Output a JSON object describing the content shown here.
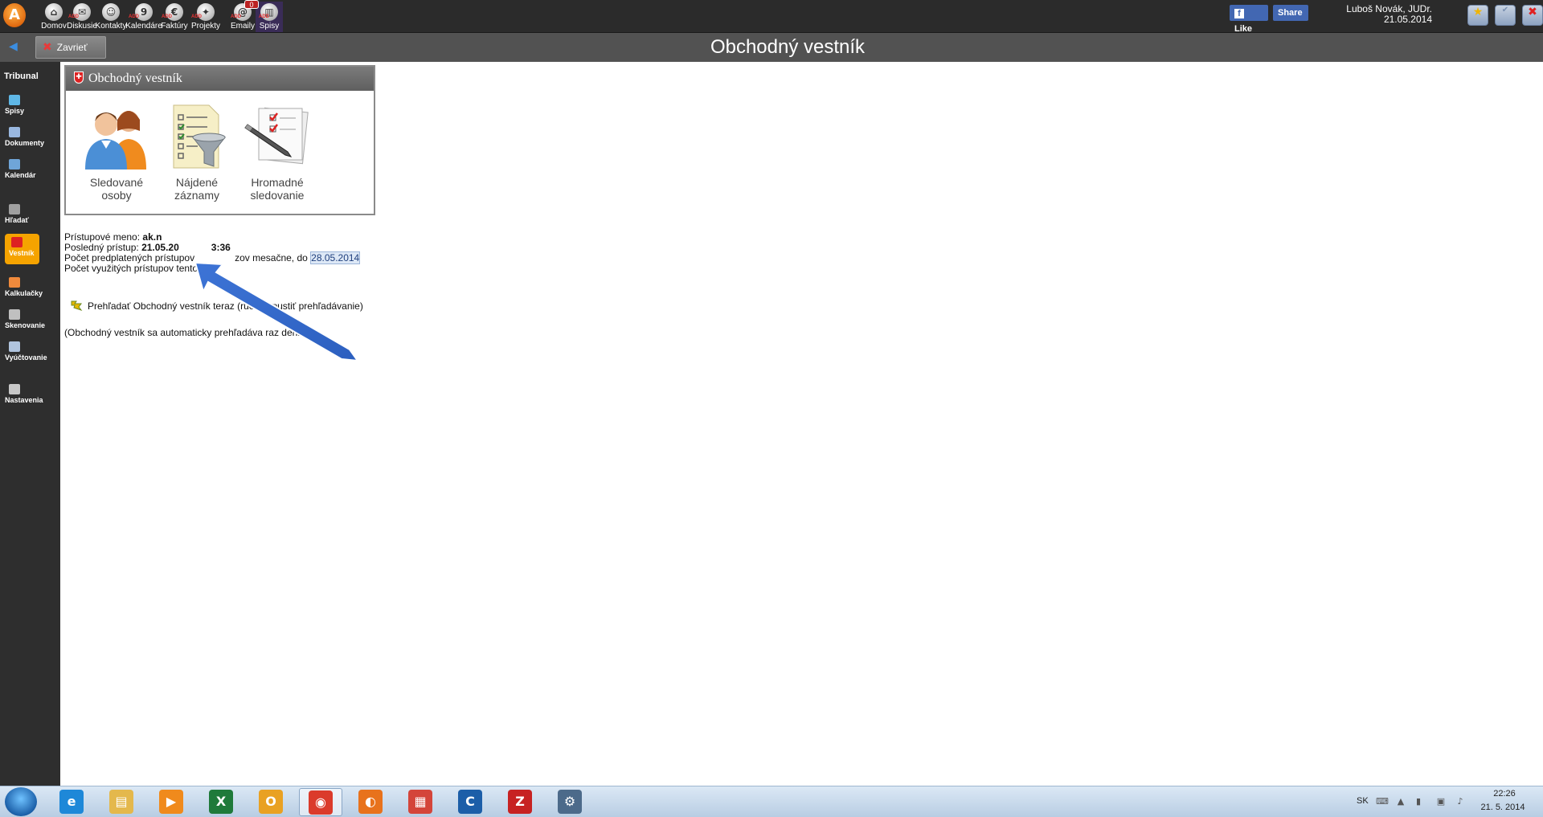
{
  "app": {
    "logo_letter": "A",
    "nav": [
      {
        "label": "Domov",
        "icon": "home-icon",
        "glyph": "⌂"
      },
      {
        "label": "Diskusie",
        "icon": "discussion-icon",
        "glyph": "✉",
        "sub": "ADD"
      },
      {
        "label": "Kontakty",
        "icon": "contacts-icon",
        "glyph": "☺"
      },
      {
        "label": "Kalendáre",
        "icon": "calendar-icon",
        "glyph": "9",
        "sub": "ADD"
      },
      {
        "label": "Faktúry",
        "icon": "invoice-icon",
        "glyph": "€",
        "sub": "ADD"
      },
      {
        "label": "Projekty",
        "icon": "projects-icon",
        "glyph": "✦",
        "sub": "ADD"
      },
      {
        "label": "Emaily",
        "icon": "email-icon",
        "glyph": "@",
        "sub": "ADD"
      },
      {
        "label": "Spisy",
        "icon": "files-icon",
        "glyph": "▥",
        "sub": "ADD"
      }
    ],
    "email_badge": "0",
    "facebook": {
      "like_label": "Like",
      "share_label": "Share"
    },
    "user": {
      "name": "Luboš Novák, JUDr.",
      "date": "21.05.2014"
    }
  },
  "titlebar": {
    "close_label": "Zavrieť",
    "page_title": "Obchodný vestník"
  },
  "sidebar": {
    "title": "Tribunal",
    "items": [
      {
        "label": "Spisy",
        "icon": "files-icon"
      },
      {
        "label": "Dokumenty",
        "icon": "documents-icon"
      },
      {
        "label": "Kalendár",
        "icon": "calendar-icon"
      },
      {
        "label": "Hľadať",
        "icon": "search-icon"
      },
      {
        "label": "Vestník",
        "icon": "vestnik-icon",
        "active": true
      },
      {
        "label": "Kalkulačky",
        "icon": "calculator-icon"
      },
      {
        "label": "Skenovanie",
        "icon": "scanner-icon"
      },
      {
        "label": "Vyúčtovanie",
        "icon": "billing-icon"
      },
      {
        "label": "Nastavenia",
        "icon": "settings-icon"
      }
    ]
  },
  "panel": {
    "title": "Obchodný vestník",
    "tiles": [
      {
        "line1": "Sledované",
        "line2": "osoby",
        "icon": "people-icon"
      },
      {
        "line1": "Nájdené",
        "line2": "záznamy",
        "icon": "filter-list-icon"
      },
      {
        "line1": "Hromadné",
        "line2": "sledovanie",
        "icon": "checklist-pen-icon"
      }
    ]
  },
  "info": {
    "login_label": "Prístupové meno:",
    "login_value": "ak.n",
    "last_access_label": "Posledný prístup:",
    "last_access_value": "21.05.20",
    "last_access_suffix": "3:36",
    "subscribed_label": "Počet predplatených prístupov",
    "subscribed_suffix": "zov mesačne, do",
    "subscribed_until": "28.05.2014",
    "used_label": "Počet využitých prístupov tento me"
  },
  "scan_link": "Prehľadať Obchodný vestník teraz (ručne spustiť prehľadávanie)",
  "auto_note": "(Obchodný vestník sa automaticky prehľadáva raz denne.)",
  "taskbar": {
    "apps": [
      {
        "name": "internet-explorer-icon",
        "glyph": "e",
        "color": "#1e88d8"
      },
      {
        "name": "file-explorer-icon",
        "glyph": "▤",
        "color": "#e4b84c"
      },
      {
        "name": "media-player-icon",
        "glyph": "▶",
        "color": "#f08a1c"
      },
      {
        "name": "excel-icon",
        "glyph": "X",
        "color": "#1f7a3a"
      },
      {
        "name": "outlook-icon",
        "glyph": "O",
        "color": "#e9a123"
      },
      {
        "name": "chrome-icon",
        "glyph": "◉",
        "color": "#db3b2b",
        "active": true
      },
      {
        "name": "firefox-icon",
        "glyph": "◐",
        "color": "#e8721c"
      },
      {
        "name": "apps-grid-icon",
        "glyph": "▦",
        "color": "#d4453a"
      },
      {
        "name": "ccleaner-icon",
        "glyph": "C",
        "color": "#1c5ea8"
      },
      {
        "name": "filezilla-icon",
        "glyph": "Z",
        "color": "#c72222"
      },
      {
        "name": "network-tool-icon",
        "glyph": "⚙",
        "color": "#4c6a8a"
      }
    ],
    "lang": "SK",
    "time": "22:26",
    "date": "21. 5. 2014"
  }
}
